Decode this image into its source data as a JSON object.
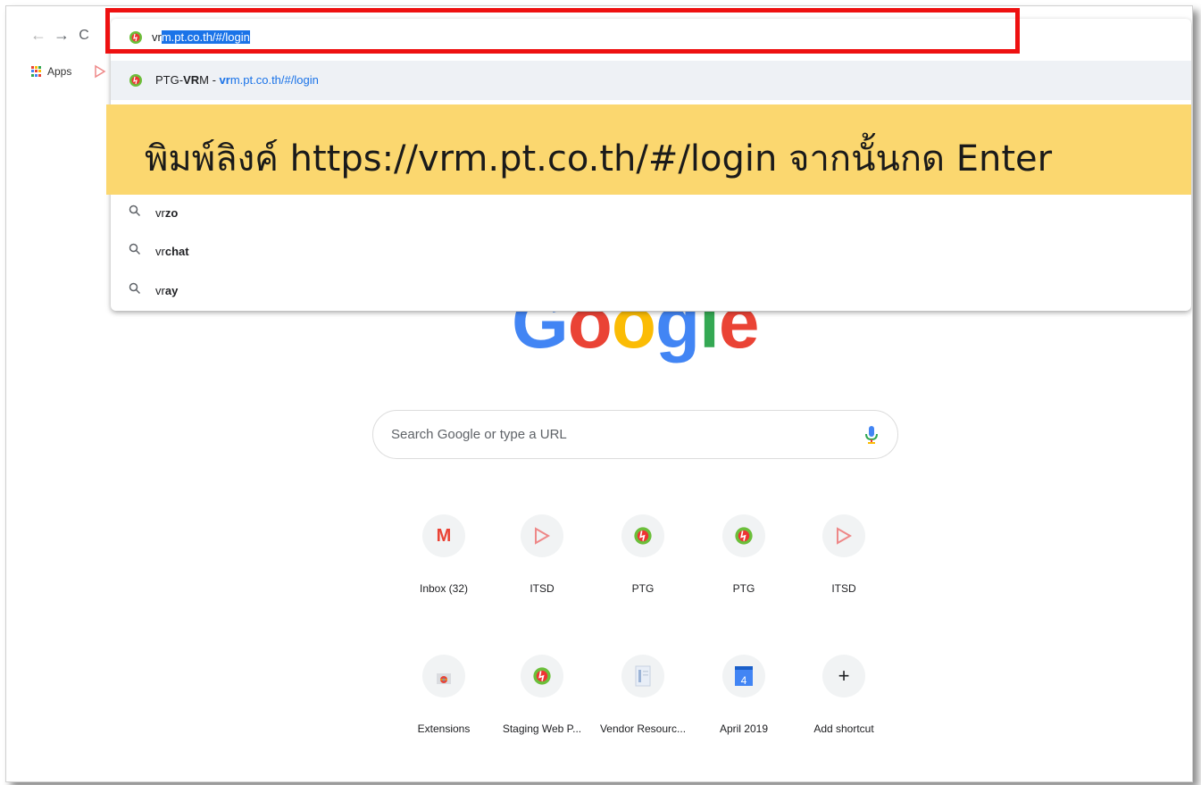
{
  "browser": {
    "nav": {
      "back": "←",
      "forward": "→",
      "reload": "C"
    },
    "bookmarks": {
      "apps_label": "Apps"
    },
    "omnibox": {
      "typed": "vr",
      "autocomplete": "m.pt.co.th/#/login"
    }
  },
  "suggestions": {
    "first": {
      "title_prefix": "PTG-",
      "title_bold": "VR",
      "title_suffix": "M",
      "separator": " - ",
      "url_bold": "vr",
      "url_rest": "m.pt.co.th/#/login"
    },
    "items": [
      {
        "prefix": "vr",
        "bold": "zo"
      },
      {
        "prefix": "vr",
        "bold": "chat"
      },
      {
        "prefix": "vr",
        "bold": "ay"
      }
    ]
  },
  "annotation": {
    "text": "พิมพ์ลิงค์ https://vrm.pt.co.th/#/login จากนั้นกด Enter"
  },
  "google": {
    "logo_letters": [
      "G",
      "o",
      "o",
      "g",
      "l",
      "e"
    ],
    "logo_colors": [
      "#4285f4",
      "#ea4335",
      "#fbbc05",
      "#4285f4",
      "#34a853",
      "#ea4335"
    ],
    "search_placeholder": "Search Google or type a URL"
  },
  "shortcuts": [
    {
      "label": "Inbox (32)",
      "icon": "gmail-icon",
      "glyph": "M"
    },
    {
      "label": "ITSD",
      "icon": "play-icon"
    },
    {
      "label": "PTG",
      "icon": "ptg-icon"
    },
    {
      "label": "PTG",
      "icon": "ptg-icon"
    },
    {
      "label": "ITSD",
      "icon": "play-icon"
    },
    {
      "label": "Extensions",
      "icon": "chrome-store-icon"
    },
    {
      "label": "Staging Web P...",
      "icon": "ptg-icon"
    },
    {
      "label": "Vendor Resourc...",
      "icon": "document-icon"
    },
    {
      "label": "April 2019",
      "icon": "calendar-icon",
      "glyph": "4"
    },
    {
      "label": "Add shortcut",
      "icon": "plus-icon",
      "glyph": "+"
    }
  ]
}
